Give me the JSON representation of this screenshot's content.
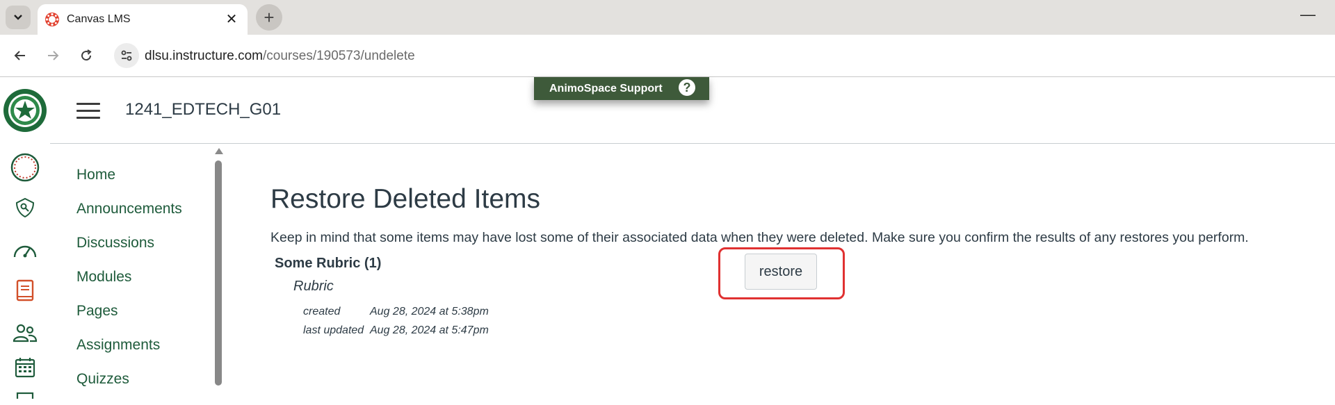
{
  "browser": {
    "tab": {
      "title": "Canvas LMS",
      "favicon": "canvas-logo-icon",
      "close_glyph": "✕"
    },
    "new_tab_glyph": "+",
    "minimize_glyph": "—",
    "address": {
      "domain": "dlsu.instructure.com",
      "path": "/courses/190573/undelete"
    },
    "icons": [
      "tab-list-chevron-icon",
      "back-arrow-icon",
      "forward-arrow-icon",
      "reload-icon",
      "site-info-icon"
    ]
  },
  "support_banner": {
    "label": "AnimoSpace Support",
    "help_glyph": "?"
  },
  "header": {
    "course_title": "1241_EDTECH_G01"
  },
  "global_nav": {
    "items": [
      "dlsu-logo-icon",
      "account-icon",
      "admin-icon",
      "dashboard-icon",
      "courses-icon",
      "groups-icon",
      "calendar-icon"
    ]
  },
  "course_nav": {
    "items": [
      {
        "label": "Home"
      },
      {
        "label": "Announcements"
      },
      {
        "label": "Discussions"
      },
      {
        "label": "Modules"
      },
      {
        "label": "Pages"
      },
      {
        "label": "Assignments"
      },
      {
        "label": "Quizzes"
      }
    ]
  },
  "main": {
    "heading": "Restore Deleted Items",
    "intro": "Keep in mind that some items may have lost some of their associated data when they were deleted. Make sure you confirm the results of any restores you perform.",
    "item": {
      "name": "Some Rubric (1)",
      "type": "Rubric",
      "created_label": "created",
      "created_value": "Aug 28, 2024 at 5:38pm",
      "updated_label": "last updated",
      "updated_value": "Aug 28, 2024 at 5:47pm",
      "restore_label": "restore"
    }
  },
  "colors": {
    "canvas_green": "#1e5b3b",
    "banner_green": "#3e5a3a",
    "highlight_red": "#e03131",
    "text": "#2d3b45"
  }
}
